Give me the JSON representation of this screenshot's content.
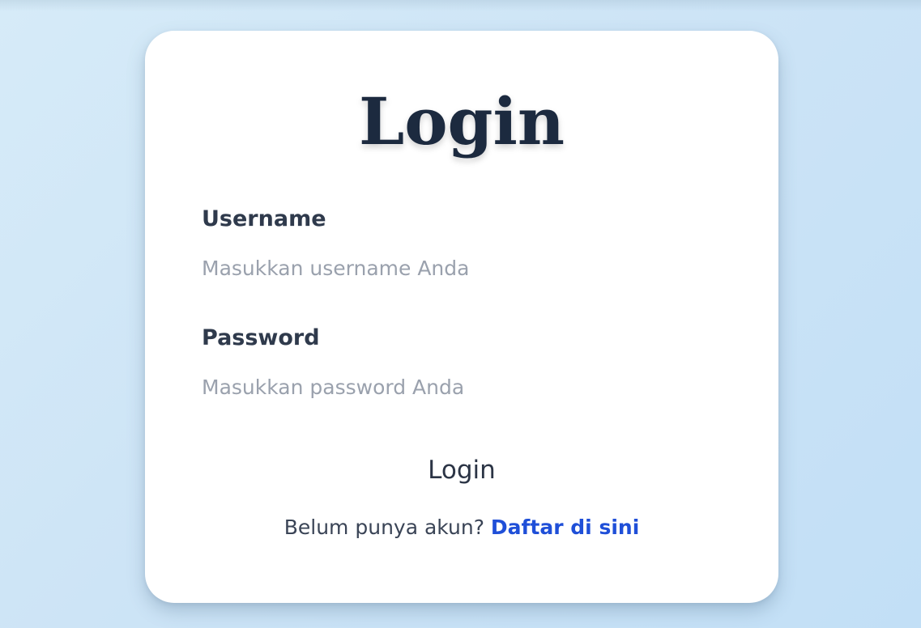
{
  "login": {
    "title": "Login",
    "username": {
      "label": "Username",
      "placeholder": "Masukkan username Anda",
      "value": ""
    },
    "password": {
      "label": "Password",
      "placeholder": "Masukkan password Anda",
      "value": ""
    },
    "submit_label": "Login",
    "register_prompt": "Belum punya akun?",
    "register_link": "Daftar di sini"
  },
  "colors": {
    "title": "#1c2a3f",
    "label": "#2f3a4c",
    "placeholder": "#9aa1ad",
    "link": "#1f4fd8",
    "card": "#ffffff",
    "background": "#cde4f6"
  }
}
